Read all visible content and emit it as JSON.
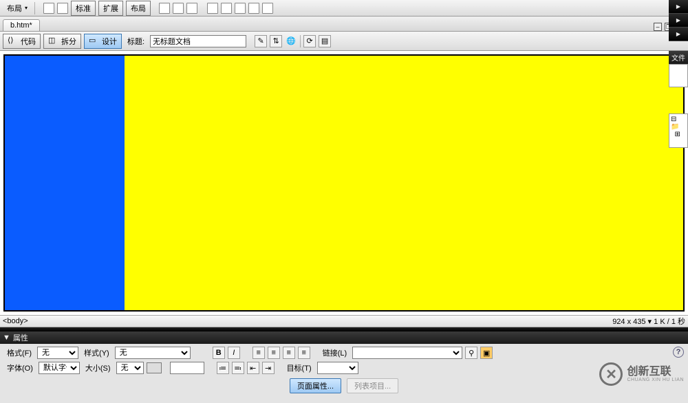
{
  "menubar": {
    "layout": "布局",
    "btn_std": "标准",
    "btn_exp": "扩展",
    "btn_lay": "布局"
  },
  "tabs": {
    "doc_name": "b.htm*"
  },
  "winctrl": {
    "min": "–",
    "restore": "❐",
    "close": "✕"
  },
  "views": {
    "code": "代码",
    "split": "拆分",
    "design": "设计",
    "title_label": "标题:",
    "title_value": "无标题文档"
  },
  "canvas": {
    "blue": "#0a5cff",
    "yellow": "#ffff00"
  },
  "statusbar": {
    "tag": "<body>",
    "dims": "924 x 435 ▾ 1 K / 1 秒"
  },
  "panel": {
    "props": "属性"
  },
  "props": {
    "format_lbl": "格式(F)",
    "format_val": "无",
    "style_lbl": "样式(Y)",
    "style_val": "无",
    "font_lbl": "字体(O)",
    "font_val": "默认字体",
    "size_lbl": "大小(S)",
    "size_val": "无",
    "link_lbl": "链接(L)",
    "target_lbl": "目标(T)",
    "bold": "B",
    "italic": "I",
    "page_props": "页面属性...",
    "list_item": "列表项目...",
    "help": "?"
  },
  "right": {
    "files": "文件"
  },
  "logo": {
    "name": "创新互联",
    "sub": "CHUANG XIN HU LIAN"
  }
}
